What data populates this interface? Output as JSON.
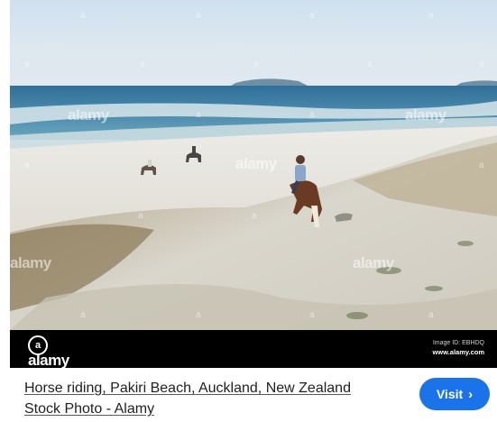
{
  "image": {
    "alt": "Horse riding on sandy dunes of Pakiri Beach",
    "watermark": "alamy",
    "watermark_small": "a"
  },
  "footer": {
    "brand": "alamy",
    "image_id_label": "Image ID: EBHDQ",
    "site": "www.alamy.com"
  },
  "result": {
    "title_line1": "Horse riding, Pakiri Beach, Auckland, New Zealand",
    "title_line2": "Stock Photo - Alamy",
    "visit_label": "Visit"
  },
  "colors": {
    "button": "#1a73e8",
    "footer_bg": "#000000"
  },
  "icons": {
    "logo": "camera-lens-icon",
    "visit": "chevron-right-icon"
  }
}
